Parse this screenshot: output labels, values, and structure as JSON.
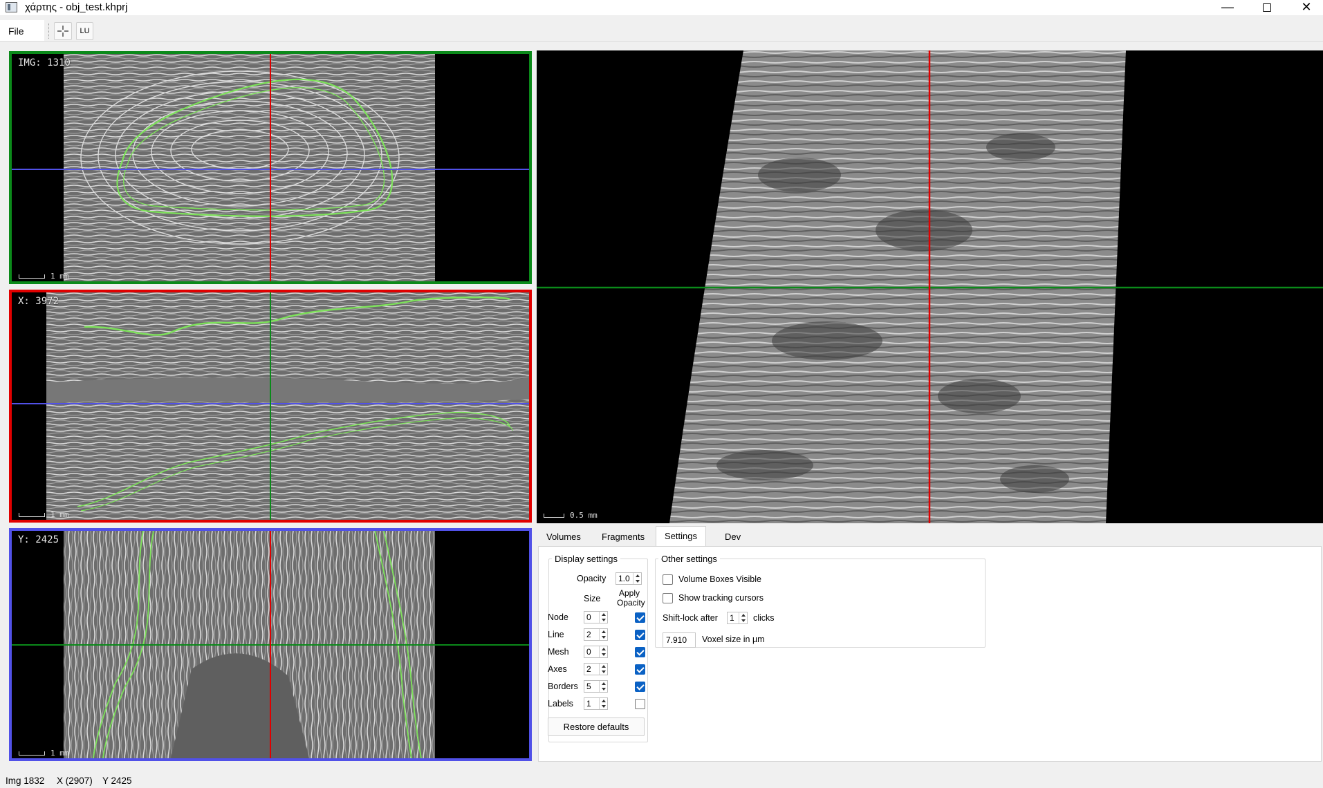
{
  "window": {
    "title": "χάρτης - obj_test.khprj",
    "minimize": "—",
    "close": "✕"
  },
  "menu": {
    "file": "File"
  },
  "toolbar": {
    "lu_label": "LU",
    "crosshair_icon": "crosshair-icon"
  },
  "colors": {
    "img_view": "#0b8a1a",
    "x_view": "#e00000",
    "y_view": "#5151e8",
    "segment": "#7de25a"
  },
  "views": {
    "img": {
      "label": "IMG: 1310",
      "scale": "1 mm"
    },
    "x": {
      "label": "X: 3972",
      "scale": "1 mm"
    },
    "y": {
      "label": "Y: 2425",
      "scale": "1 mm"
    },
    "render3d": {
      "scale": "0.5 mm"
    }
  },
  "tabs": [
    "Volumes",
    "Fragments",
    "Settings",
    "Dev Tools"
  ],
  "active_tab": "Settings",
  "display_settings": {
    "title": "Display settings",
    "opacity_label": "Opacity",
    "opacity_value": "1.0",
    "size_header": "Size",
    "apply_header_1": "Apply",
    "apply_header_2": "Opacity",
    "rows": [
      {
        "label": "Node",
        "size": "0",
        "apply": true
      },
      {
        "label": "Line",
        "size": "2",
        "apply": true
      },
      {
        "label": "Mesh",
        "size": "0",
        "apply": true
      },
      {
        "label": "Axes",
        "size": "2",
        "apply": true
      },
      {
        "label": "Borders",
        "size": "5",
        "apply": true
      },
      {
        "label": "Labels",
        "size": "1",
        "apply": false
      }
    ],
    "restore_button": "Restore defaults"
  },
  "other_settings": {
    "title": "Other settings",
    "volume_boxes": {
      "label": "Volume Boxes Visible",
      "checked": false
    },
    "tracking_cursors": {
      "label": "Show tracking cursors",
      "checked": false
    },
    "shift_lock_prefix": "Shift-lock after",
    "shift_lock_value": "1",
    "shift_lock_suffix": "clicks",
    "voxel_value": "7.910",
    "voxel_label": "Voxel size in µm"
  },
  "status": {
    "img": "Img 1832",
    "x": "X (2907)",
    "y": "Y 2425"
  }
}
